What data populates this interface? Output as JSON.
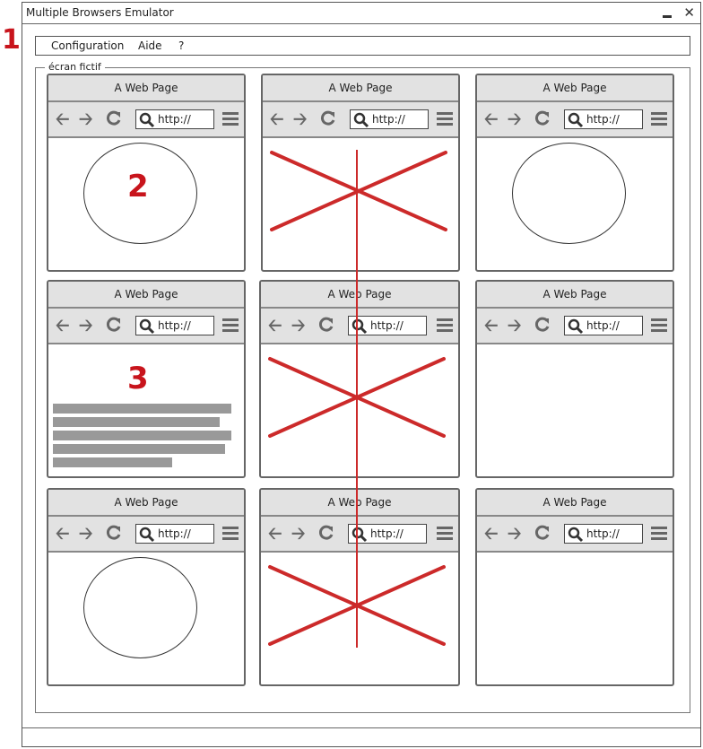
{
  "annotations": [
    "1",
    "2",
    "3"
  ],
  "window": {
    "title": "Multiple Browsers Emulator",
    "close_symbol": "✕"
  },
  "menu": {
    "items": [
      "Configuration",
      "Aide",
      "?"
    ]
  },
  "fieldset": {
    "legend": "écran fictif"
  },
  "browser": {
    "title": "A Web Page",
    "url": "http://"
  },
  "icons": {
    "back": "arrow-left-icon",
    "forward": "arrow-right-icon",
    "reload": "reload-icon",
    "search": "search-icon",
    "menu": "hamburger-menu-icon"
  },
  "colors": {
    "annotation": "#c8141c",
    "cross": "#cc2a2a",
    "chrome": "#e2e2e2"
  },
  "grid": {
    "rows": 3,
    "cols": 3,
    "cells": [
      {
        "content": "circle"
      },
      {
        "content": "cross"
      },
      {
        "content": "circle"
      },
      {
        "content": "text"
      },
      {
        "content": "cross"
      },
      {
        "content": "empty"
      },
      {
        "content": "circle"
      },
      {
        "content": "cross"
      },
      {
        "content": "empty"
      }
    ]
  }
}
